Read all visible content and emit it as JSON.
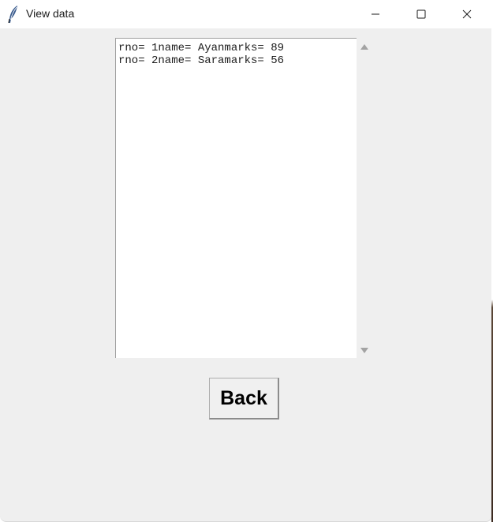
{
  "window": {
    "title": "View data",
    "app_icon": "feather-icon",
    "controls": {
      "minimize_icon": "minimize-icon",
      "maximize_icon": "maximize-icon",
      "close_icon": "close-icon"
    }
  },
  "records_text": {
    "lines": [
      "rno= 1name= Ayanmarks= 89",
      "rno= 2name= Saramarks= 56"
    ]
  },
  "scrollbar": {
    "up_icon": "scroll-up-arrow-icon",
    "down_icon": "scroll-down-arrow-icon"
  },
  "actions": {
    "back_label": "Back"
  },
  "colors": {
    "window_bg": "#efefef",
    "titlebar_bg": "#ffffff",
    "text_area_bg": "#ffffff",
    "scroll_arrow": "#a3a3a3"
  }
}
